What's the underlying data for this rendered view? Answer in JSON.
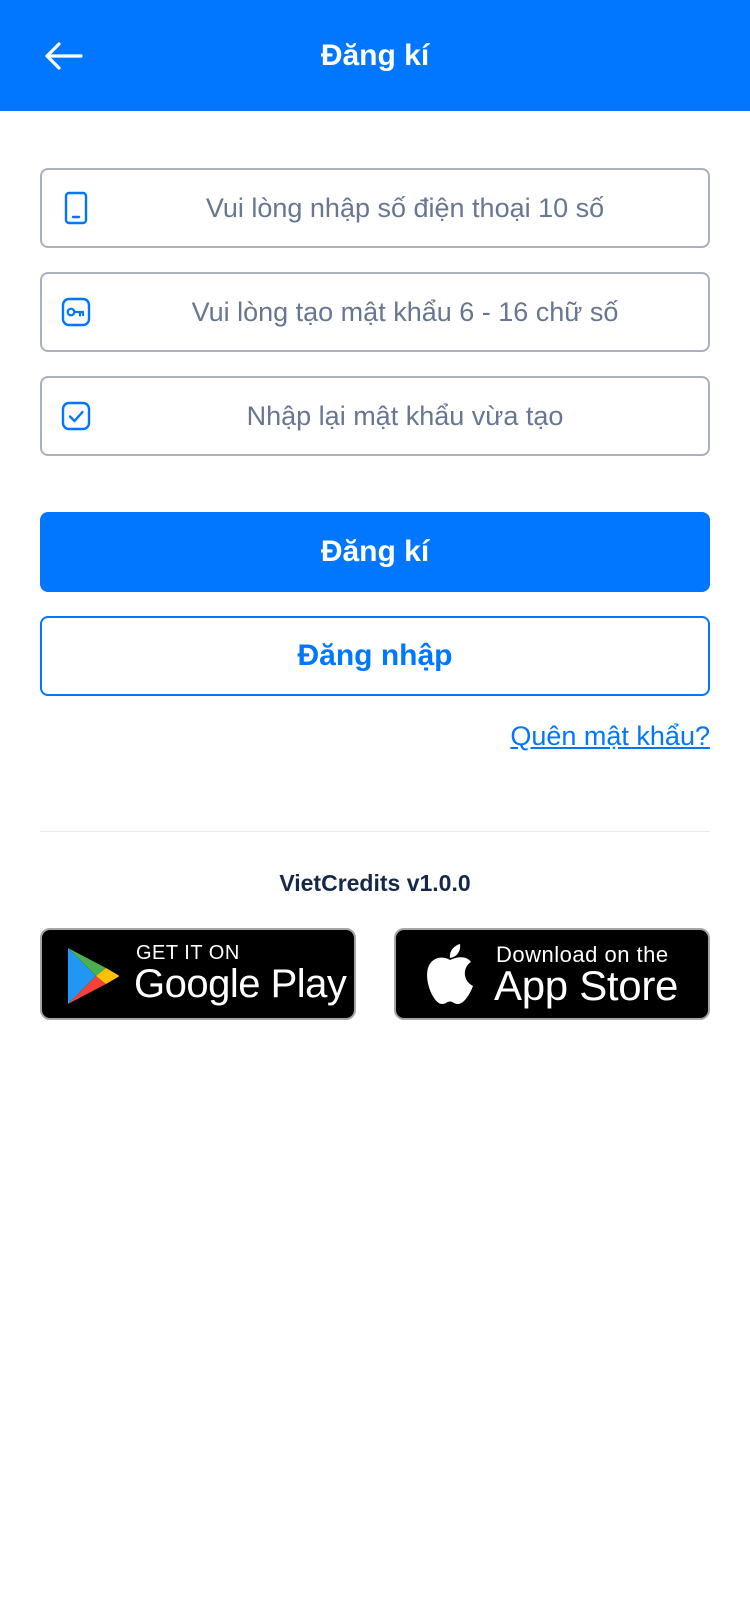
{
  "header": {
    "title": "Đăng kí",
    "back_icon": "arrow-left-icon"
  },
  "form": {
    "phone": {
      "placeholder": "Vui lòng nhập số điện thoại 10 số",
      "value": "",
      "icon": "phone-icon"
    },
    "password": {
      "placeholder": "Vui lòng tạo mật khẩu 6 - 16 chữ số",
      "value": "",
      "icon": "key-icon"
    },
    "confirm_password": {
      "placeholder": "Nhập lại mật khẩu vừa tạo",
      "value": "",
      "icon": "check-box-icon"
    }
  },
  "actions": {
    "register_label": "Đăng kí",
    "login_label": "Đăng nhập",
    "forgot_label": "Quên mật khẩu?"
  },
  "footer": {
    "version": "VietCredits v1.0.0",
    "google_play": {
      "small": "GET IT ON",
      "big": "Google Play"
    },
    "app_store": {
      "small": "Download on the",
      "big": "App Store"
    }
  },
  "colors": {
    "primary": "#0177ff",
    "border": "#a9b1bf",
    "placeholder": "#677691",
    "version_text": "#14294a"
  }
}
